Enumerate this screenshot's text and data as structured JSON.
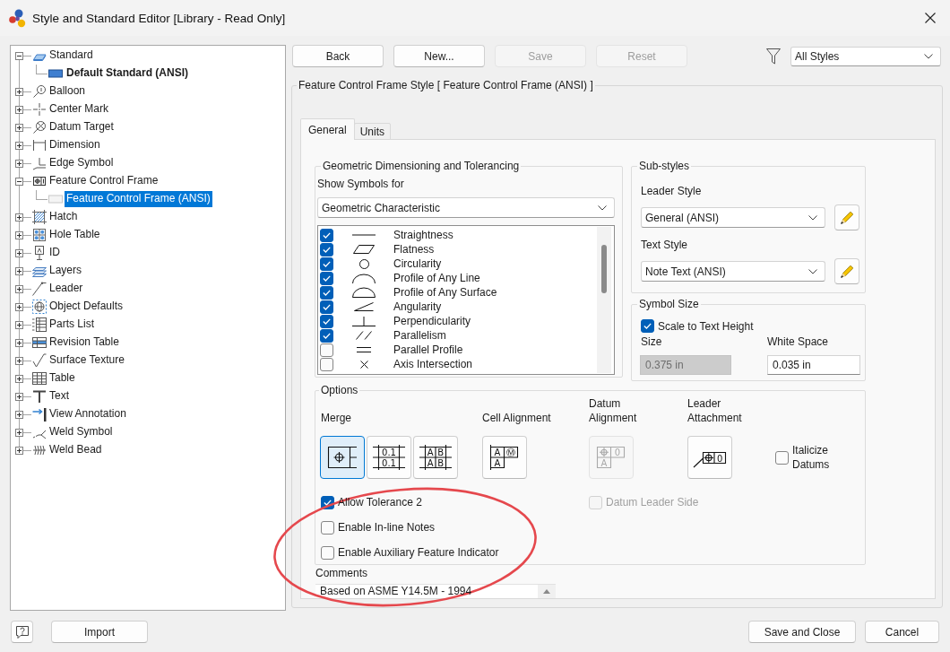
{
  "window": {
    "title": "Style and Standard Editor [Library - Read Only]"
  },
  "tree": [
    {
      "label": "Standard",
      "expanded": true,
      "selected": false,
      "children": [
        {
          "label": "Default Standard (ANSI)",
          "active": true,
          "selected": false
        }
      ]
    },
    {
      "label": "Balloon",
      "expanded": false,
      "selected": false
    },
    {
      "label": "Center Mark",
      "expanded": false,
      "selected": false
    },
    {
      "label": "Datum Target",
      "expanded": false,
      "selected": false
    },
    {
      "label": "Dimension",
      "expanded": false,
      "selected": false
    },
    {
      "label": "Edge Symbol",
      "expanded": false,
      "selected": false
    },
    {
      "label": "Feature Control Frame",
      "expanded": true,
      "selected": false,
      "children": [
        {
          "label": "Feature Control Frame (ANSI)",
          "active": false,
          "selected": true
        }
      ]
    },
    {
      "label": "Hatch",
      "expanded": false,
      "selected": false
    },
    {
      "label": "Hole Table",
      "expanded": false,
      "selected": false
    },
    {
      "label": "ID",
      "expanded": false,
      "selected": false
    },
    {
      "label": "Layers",
      "expanded": false,
      "selected": false
    },
    {
      "label": "Leader",
      "expanded": false,
      "selected": false
    },
    {
      "label": "Object Defaults",
      "expanded": false,
      "selected": false
    },
    {
      "label": "Parts List",
      "expanded": false,
      "selected": false
    },
    {
      "label": "Revision Table",
      "expanded": false,
      "selected": false
    },
    {
      "label": "Surface Texture",
      "expanded": false,
      "selected": false
    },
    {
      "label": "Table",
      "expanded": false,
      "selected": false
    },
    {
      "label": "Text",
      "expanded": false,
      "selected": false
    },
    {
      "label": "View Annotation",
      "expanded": false,
      "selected": false
    },
    {
      "label": "Weld Symbol",
      "expanded": false,
      "selected": false
    },
    {
      "label": "Weld Bead",
      "expanded": false,
      "selected": false
    }
  ],
  "toolbar": {
    "buttons": [
      {
        "label": "Back",
        "disabled": false
      },
      {
        "label": "New...",
        "disabled": false
      },
      {
        "label": "Save",
        "disabled": true
      },
      {
        "label": "Reset",
        "disabled": true
      }
    ],
    "filter": {
      "value": "All Styles"
    }
  },
  "style_frame": {
    "title": "Feature Control Frame Style [ Feature Control Frame (ANSI) ]",
    "tabs": [
      {
        "label": "General",
        "selected": true
      },
      {
        "label": "Units",
        "selected": false
      }
    ],
    "gdt": {
      "title": "Geometric Dimensioning and Tolerancing",
      "show_symbols": {
        "label": "Show Symbols for",
        "value": "Geometric Characteristic"
      },
      "symbols": [
        {
          "name": "Straightness",
          "checked": true
        },
        {
          "name": "Flatness",
          "checked": true
        },
        {
          "name": "Circularity",
          "checked": true
        },
        {
          "name": "Profile of Any Line",
          "checked": true
        },
        {
          "name": "Profile of Any Surface",
          "checked": true
        },
        {
          "name": "Angularity",
          "checked": true
        },
        {
          "name": "Perpendicularity",
          "checked": true
        },
        {
          "name": "Parallelism",
          "checked": true
        },
        {
          "name": "Parallel Profile",
          "checked": false
        },
        {
          "name": "Axis Intersection",
          "checked": false
        }
      ]
    },
    "sub_styles": {
      "title": "Sub-styles",
      "fields": [
        {
          "label": "Leader Style",
          "value": "General (ANSI)"
        },
        {
          "label": "Text Style",
          "value": "Note Text (ANSI)"
        }
      ]
    },
    "symbol_size": {
      "title": "Symbol Size",
      "scale_to_text_height": {
        "label": "Scale to Text Height",
        "checked": true
      },
      "fields": [
        {
          "label": "Size",
          "value": "0.375 in",
          "disabled": true
        },
        {
          "label": "White Space",
          "value": "0.035 in",
          "disabled": false
        }
      ]
    },
    "options": {
      "title": "Options",
      "merge": {
        "label": "Merge",
        "buttons": [
          {
            "selected": true
          },
          {
            "selected": false,
            "cells": [
              "0.1",
              "0.1"
            ]
          },
          {
            "selected": false,
            "cells": [
              "A",
              "B",
              "A",
              "B"
            ]
          }
        ]
      },
      "cell_alignment": {
        "label": "Cell Alignment",
        "cells": [
          "A",
          "Ⓜ",
          "A"
        ]
      },
      "datum_alignment": {
        "label": "Datum Alignment",
        "disabled": true,
        "cells": [
          "0",
          "A"
        ]
      },
      "leader_attachment": {
        "label": "Leader Attachment",
        "cells": [
          "0"
        ]
      },
      "italicize_datums": {
        "label": "Italicize Datums",
        "checked": false
      },
      "checkbox_rows": [
        [
          {
            "label": "Allow Tolerance 2",
            "checked": true,
            "disabled": false
          },
          {
            "label": "Datum Leader Side",
            "checked": false,
            "disabled": true
          }
        ],
        [
          {
            "label": "Enable In-line Notes",
            "checked": false,
            "disabled": false
          }
        ],
        [
          {
            "label": "Enable Auxiliary Feature Indicator",
            "checked": false,
            "disabled": false
          }
        ]
      ]
    },
    "comments": {
      "label": "Comments",
      "value": "Based on ASME Y14.5M - 1994"
    }
  },
  "footer": {
    "import": "Import",
    "save_and_close": "Save and Close",
    "cancel": "Cancel"
  }
}
